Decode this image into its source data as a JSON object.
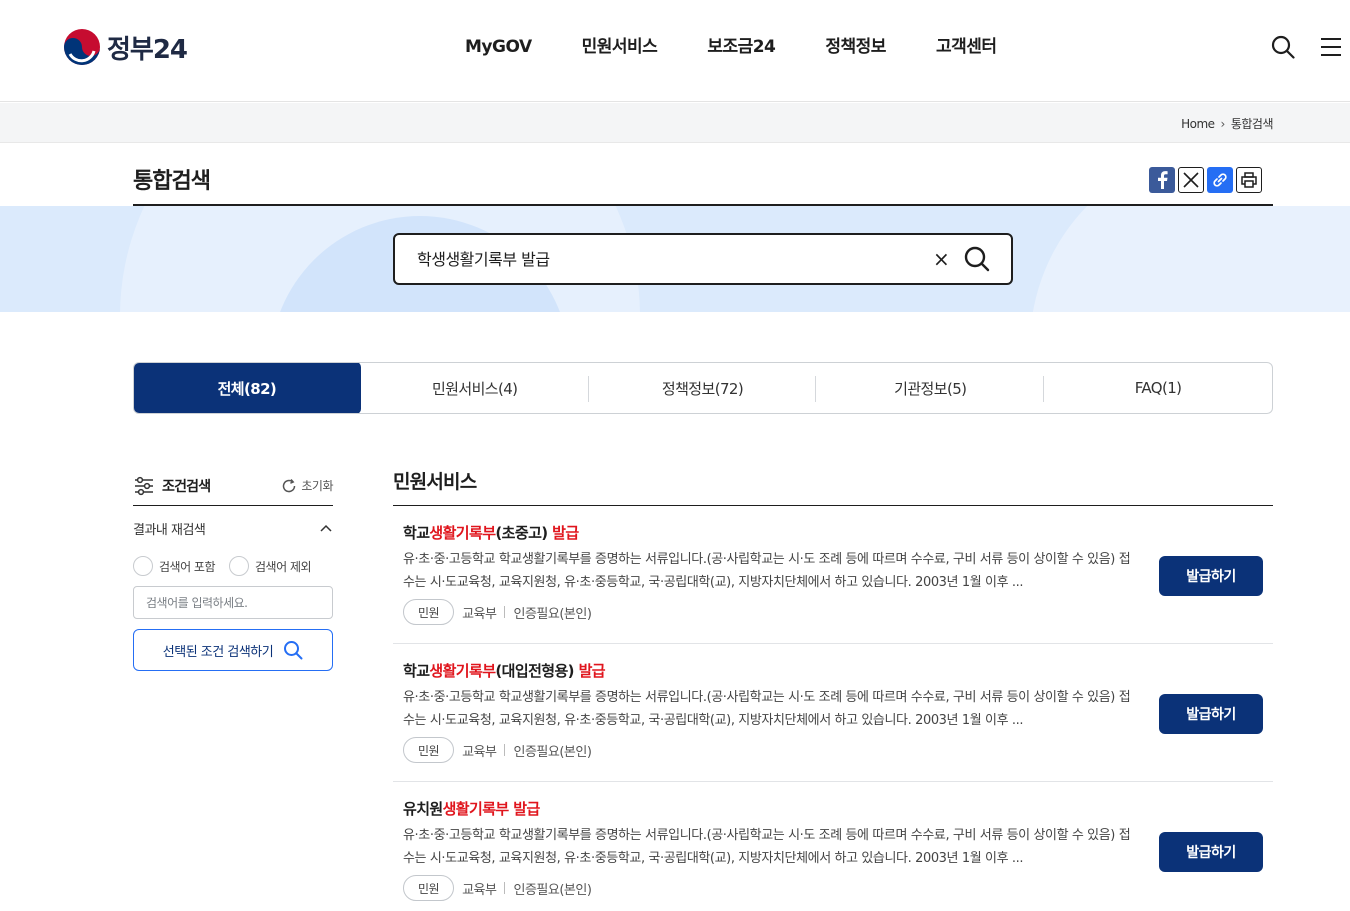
{
  "header": {
    "logo_text": "정부24",
    "nav": [
      "MyGOV",
      "민원서비스",
      "보조금24",
      "정책정보",
      "고객센터"
    ],
    "search_icon": "search-icon",
    "menu_icon": "hamburger-menu-icon"
  },
  "breadcrumb": {
    "home": "Home",
    "current": "통합검색"
  },
  "page": {
    "title": "통합검색"
  },
  "share": {
    "facebook": "facebook-icon",
    "x": "x-icon",
    "link": "link-icon",
    "print": "print-icon"
  },
  "search": {
    "value": "학생생활기록부 발급",
    "clear": "×"
  },
  "tabs": [
    {
      "label": "전체(82)",
      "active": true
    },
    {
      "label": "민원서비스(4)",
      "active": false
    },
    {
      "label": "정책정보(72)",
      "active": false
    },
    {
      "label": "기관정보(5)",
      "active": false
    },
    {
      "label": "FAQ(1)",
      "active": false
    }
  ],
  "filter": {
    "title": "조건검색",
    "reset": "초기화",
    "refine_label": "결과내 재검색",
    "include_label": "검색어 포함",
    "exclude_label": "검색어 제외",
    "input_placeholder": "검색어를 입력하세요.",
    "search_button": "선택된 조건 검색하기"
  },
  "results": {
    "section_title": "민원서비스",
    "items": [
      {
        "title_pre": "학교",
        "title_hl": "생활기록부",
        "title_post": "(초중고) ",
        "title_hl2": "발급",
        "desc": "유·초·중·고등학교 학교생활기록부를 증명하는 서류입니다.(공·사립학교는 시·도 조례 등에 따르며 수수료, 구비 서류 등이 상이할 수 있음) 접수는 시·도교육청, 교육지원청, 유·초·중등학교, 국·공립대학(교), 지방자치단체에서 하고 있습니다. 2003년 1월 이후 ...",
        "badge": "민원",
        "agency": "교육부",
        "auth": "인증필요(본인)",
        "button": "발급하기"
      },
      {
        "title_pre": "학교",
        "title_hl": "생활기록부",
        "title_post": "(대입전형용) ",
        "title_hl2": "발급",
        "desc": "유·초·중·고등학교 학교생활기록부를 증명하는 서류입니다.(공·사립학교는 시·도 조례 등에 따르며 수수료, 구비 서류 등이 상이할 수 있음) 접수는 시·도교육청, 교육지원청, 유·초·중등학교, 국·공립대학(교), 지방자치단체에서 하고 있습니다. 2003년 1월 이후 ...",
        "badge": "민원",
        "agency": "교육부",
        "auth": "인증필요(본인)",
        "button": "발급하기"
      },
      {
        "title_pre": "유치원",
        "title_hl": "생활기록부",
        "title_post": " ",
        "title_hl2": "발급",
        "desc": "유·초·중·고등학교 학교생활기록부를 증명하는 서류입니다.(공·사립학교는 시·도 조례 등에 따르며 수수료, 구비 서류 등이 상이할 수 있음) 접수는 시·도교육청, 교육지원청, 유·초·중등학교, 국·공립대학(교), 지방자치단체에서 하고 있습니다. 2003년 1월 이후 ...",
        "badge": "민원",
        "agency": "교육부",
        "auth": "인증필요(본인)",
        "button": "발급하기"
      }
    ]
  },
  "colors": {
    "primary": "#0b3278",
    "highlight": "#e0151d",
    "band": "#dbeafc"
  }
}
